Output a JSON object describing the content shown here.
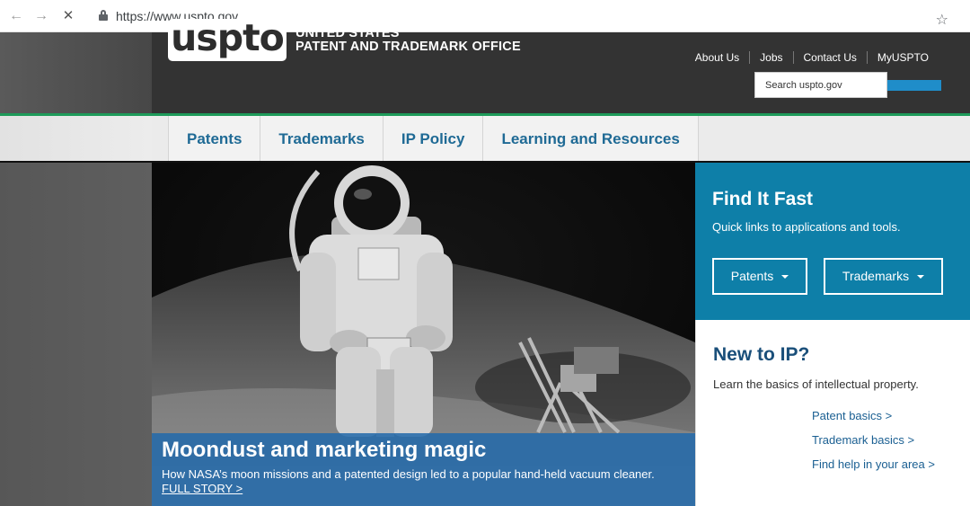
{
  "browser": {
    "url": "https://www.uspto.gov",
    "back_icon": "←",
    "forward_icon": "→",
    "stop_icon": "✕",
    "bookmark_icon": "☆"
  },
  "header": {
    "logo_text": "uspto",
    "org_line1": "UNITED STATES",
    "org_line2": "PATENT AND TRADEMARK OFFICE",
    "top_links": [
      "About Us",
      "Jobs",
      "Contact Us",
      "MyUSPTO"
    ],
    "search_placeholder": "Search uspto.gov"
  },
  "main_nav": {
    "items": [
      "Patents",
      "Trademarks",
      "IP Policy",
      "Learning and Resources"
    ]
  },
  "hero": {
    "title": "Moondust and marketing magic",
    "description": "How NASA’s moon missions and a patented design led to a popular hand-held vacuum cleaner.",
    "link_text": "FULL STORY >"
  },
  "find_it_fast": {
    "title": "Find It Fast",
    "subtitle": "Quick links to applications and tools.",
    "buttons": [
      "Patents",
      "Trademarks"
    ]
  },
  "new_to_ip": {
    "title": "New to IP?",
    "subtitle": "Learn the basics of intellectual property.",
    "links": [
      "Patent basics >",
      "Trademark basics >",
      "Find help in your area >"
    ]
  },
  "colors": {
    "accent_blue": "#0e7fa8",
    "nav_text": "#1f6a95",
    "header_dark": "#333333",
    "green_rule": "#1e9b5a"
  }
}
